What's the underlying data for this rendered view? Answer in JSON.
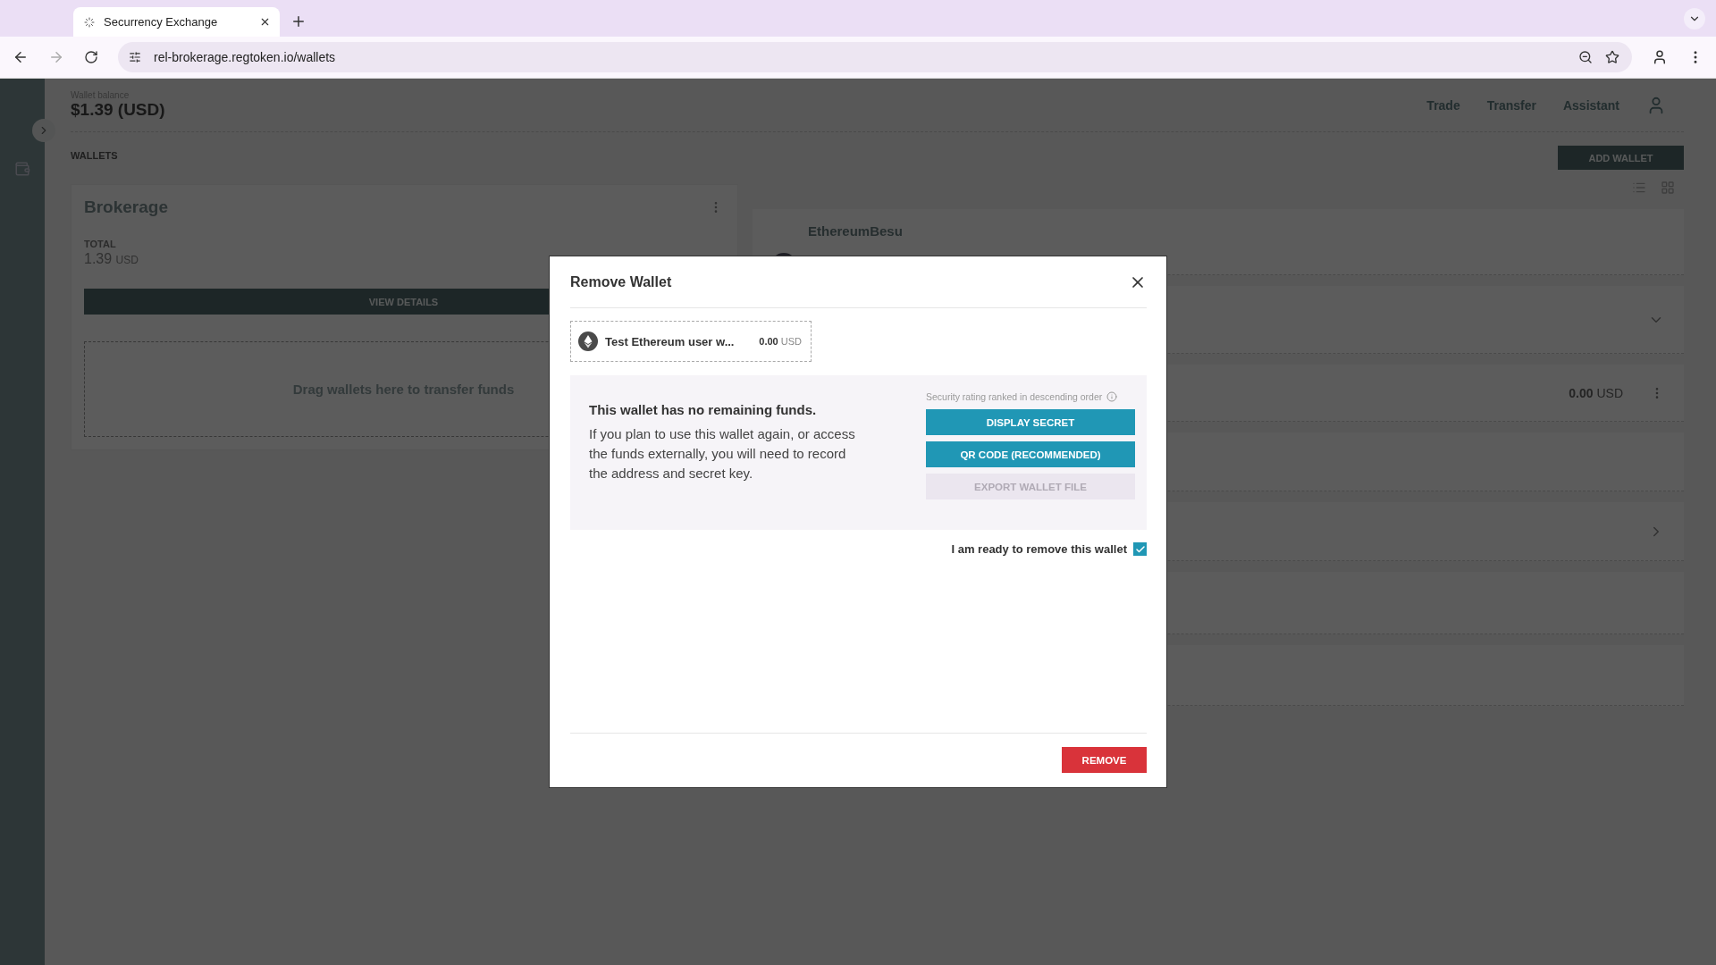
{
  "browser": {
    "tab_title": "Securrency Exchange",
    "url": "rel-brokerage.regtoken.io/wallets"
  },
  "header": {
    "balance_label": "Wallet balance",
    "balance": "$1.39 (USD)",
    "nav": [
      "Trade",
      "Transfer",
      "Assistant"
    ]
  },
  "wallets_heading": "WALLETS",
  "add_wallet": "ADD WALLET",
  "brokerage": {
    "name": "Brokerage",
    "total_label": "TOTAL",
    "amount": "1.39",
    "currency": "USD",
    "view_details": "VIEW DETAILS",
    "drop_hint": "Drag wallets here to transfer funds"
  },
  "wallet_rows": [
    {
      "kind": "named",
      "name": "EthereumBesu"
    },
    {
      "kind": "expand"
    },
    {
      "kind": "amount",
      "amount": "0.00",
      "currency": "USD"
    },
    {
      "kind": "blank"
    },
    {
      "kind": "forward"
    },
    {
      "kind": "blank"
    },
    {
      "kind": "blank"
    }
  ],
  "modal": {
    "title": "Remove Wallet",
    "wallet": {
      "name": "Test Ethereum user w...",
      "amount": "0.00",
      "currency": "USD"
    },
    "heading": "This wallet has no remaining funds.",
    "body": "If you plan to use this wallet again, or access the funds externally, you will need to record the address and secret key.",
    "security_note": "Security rating ranked in descending order",
    "actions": [
      {
        "label": "DISPLAY SECRET",
        "disabled": false
      },
      {
        "label": "QR CODE (RECOMMENDED)",
        "disabled": false
      },
      {
        "label": "EXPORT WALLET FILE",
        "disabled": true
      }
    ],
    "confirm": {
      "label": "I am ready to remove this wallet",
      "checked": true
    },
    "remove": "REMOVE"
  }
}
